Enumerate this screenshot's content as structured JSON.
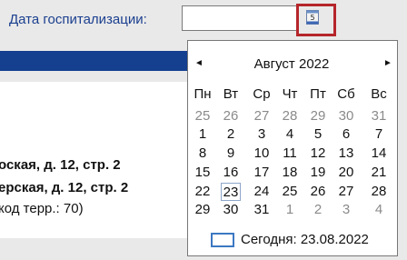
{
  "form": {
    "date_label": "Дата госпитализации:",
    "date_value": ""
  },
  "address": {
    "line1": "оская, д. 12, стр. 2",
    "line2": "ерская, д. 12, стр. 2",
    "line3": "код терр.: 70)"
  },
  "calendar": {
    "month_title": "Август 2022",
    "prev_icon": "◄",
    "next_icon": "►",
    "weekdays": [
      "Пн",
      "Вт",
      "Ср",
      "Чт",
      "Пт",
      "Сб",
      "Вс"
    ],
    "weeks": [
      [
        {
          "d": "25",
          "m": true
        },
        {
          "d": "26",
          "m": true
        },
        {
          "d": "27",
          "m": true
        },
        {
          "d": "28",
          "m": true
        },
        {
          "d": "29",
          "m": true
        },
        {
          "d": "30",
          "m": true
        },
        {
          "d": "31",
          "m": true
        }
      ],
      [
        {
          "d": "1"
        },
        {
          "d": "2"
        },
        {
          "d": "3"
        },
        {
          "d": "4"
        },
        {
          "d": "5"
        },
        {
          "d": "6"
        },
        {
          "d": "7"
        }
      ],
      [
        {
          "d": "8"
        },
        {
          "d": "9"
        },
        {
          "d": "10"
        },
        {
          "d": "11"
        },
        {
          "d": "12"
        },
        {
          "d": "13"
        },
        {
          "d": "14"
        }
      ],
      [
        {
          "d": "15"
        },
        {
          "d": "16"
        },
        {
          "d": "17"
        },
        {
          "d": "18"
        },
        {
          "d": "19"
        },
        {
          "d": "20"
        },
        {
          "d": "21"
        }
      ],
      [
        {
          "d": "22"
        },
        {
          "d": "23",
          "t": true
        },
        {
          "d": "24"
        },
        {
          "d": "25"
        },
        {
          "d": "26"
        },
        {
          "d": "27"
        },
        {
          "d": "28"
        }
      ],
      [
        {
          "d": "29"
        },
        {
          "d": "30"
        },
        {
          "d": "31"
        },
        {
          "d": "1",
          "m": true
        },
        {
          "d": "2",
          "m": true
        },
        {
          "d": "3",
          "m": true
        },
        {
          "d": "4",
          "m": true
        }
      ]
    ],
    "today_label": "Сегодня: 23.08.2022"
  },
  "colors": {
    "accent_red": "#b5262b",
    "header_blue": "#153f8f",
    "label_blue": "#1a3f8f"
  }
}
